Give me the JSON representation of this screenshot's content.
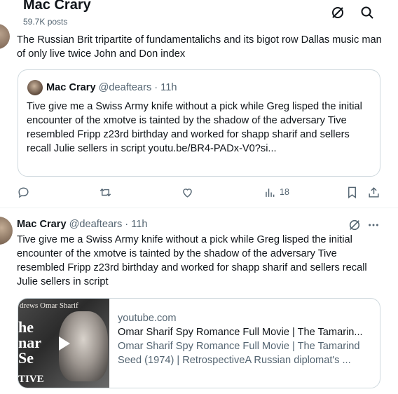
{
  "header": {
    "title": "Mac Crary",
    "subtitle": "59.7K posts"
  },
  "tweet1": {
    "text": "The Russian Brit tripartite of fundamentalichs and its bigot row Dallas music man of only live twice John and Don index",
    "quote": {
      "name": "Mac Crary",
      "handle": "@deaftears",
      "time": "· 11h",
      "text": "Tive give me a Swiss Army knife without a pick while Greg lisped the initial encounter of the xmotve is tainted by the shadow of the adversary  Tive resembled Fripp z23rd birthday and worked for shapp sharif and sellers recall Julie sellers in script youtu.be/BR4-PADx-V0?si..."
    },
    "actions": {
      "views": "18"
    }
  },
  "tweet2": {
    "name": "Mac Crary",
    "handle": "@deaftears",
    "time": "· 11h",
    "text": "Tive give me a Swiss Army knife without a pick while Greg lisped the initial encounter of the xmotve is tainted by the shadow of the adversary  Tive resembled Fripp z23rd birthday and worked for shapp sharif and sellers recall Julie sellers in script",
    "link_card": {
      "domain": "youtube.com",
      "title": "Omar Sharif Spy Romance Full Movie | The Tamarin...",
      "description": "Omar Sharif Spy Romance Full Movie | The Tamarind Seed (1974) | RetrospectiveA Russian diplomat's ...",
      "thumb_top_text": "drews  Omar Sharif",
      "thumb_big_1": "he",
      "thumb_big_2": "nar",
      "thumb_big_3": "Se",
      "thumb_big_4": "TIVE"
    }
  },
  "colors": {
    "text": "#0f1419",
    "secondary": "#536471",
    "border": "#cfd9de"
  },
  "icons": [
    "grok-icon",
    "search-icon",
    "reply-icon",
    "retweet-icon",
    "like-icon",
    "views-icon",
    "bookmark-icon",
    "share-icon",
    "more-icon",
    "play-icon"
  ]
}
